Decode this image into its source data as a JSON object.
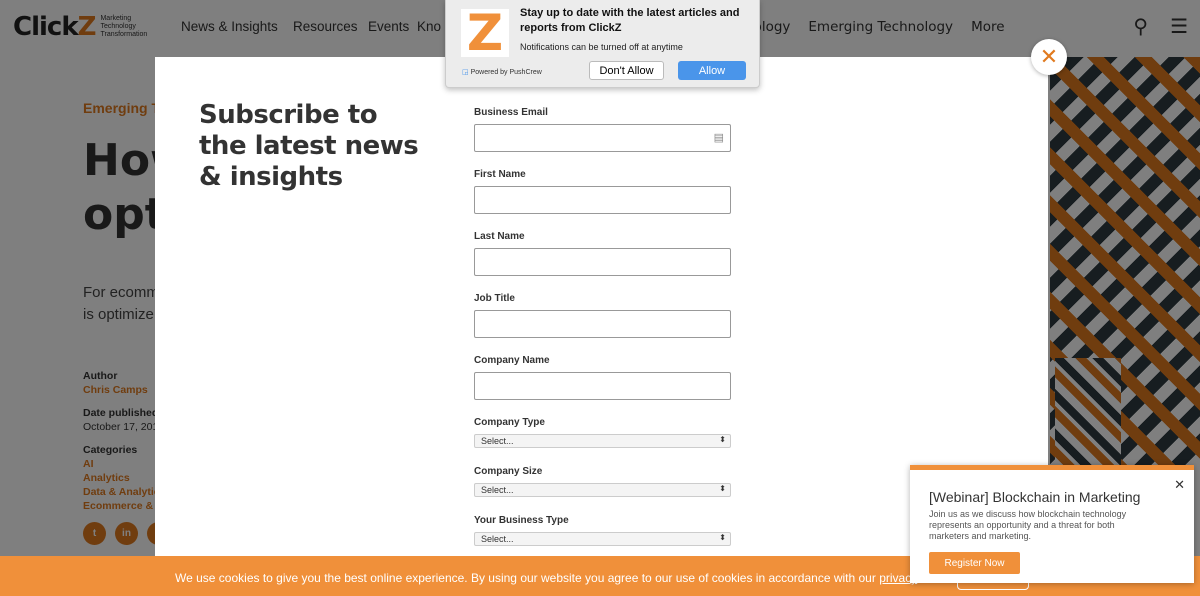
{
  "header": {
    "logo": "ClickZ",
    "logo_tagline": "Marketing Technology Transformation",
    "nav": [
      "News & Insights",
      "Resources",
      "Events",
      "Kno"
    ],
    "nav_right": [
      "nology",
      "Emerging Technology",
      "More"
    ]
  },
  "article": {
    "kicker": "Emerging Te",
    "title_lines": [
      "How",
      "opti"
    ],
    "lede_lines": [
      "For ecomm",
      "is optimize"
    ],
    "author_label": "Author",
    "author": "Chris Camps",
    "date_label": "Date published",
    "date": "October 17, 201",
    "categories_label": "Categories",
    "categories": [
      "AI",
      "Analytics",
      "Data & Analytic",
      "Ecommerce & S"
    ]
  },
  "modal": {
    "heading": "Subscribe to the latest news & insights",
    "fields": [
      "Business Email",
      "First Name",
      "Last Name",
      "Job Title",
      "Company Name"
    ],
    "selects": [
      {
        "label": "Company Type",
        "value": "Select..."
      },
      {
        "label": "Company Size",
        "value": "Select..."
      },
      {
        "label": "Your Business Type",
        "value": "Select..."
      }
    ]
  },
  "push": {
    "title": "Stay up to date with the latest articles and reports from ClickZ",
    "subtitle": "Notifications can be turned off at anytime",
    "powered": "Powered by PushCrew",
    "deny": "Don't Allow",
    "allow": "Allow",
    "logo": "Z"
  },
  "cookie": {
    "text": "We use cookies to give you the best online experience. By using our website you agree to our use of cookies in accordance with our ",
    "link": "privacy"
  },
  "webinar": {
    "title": "[Webinar] Blockchain in Marketing",
    "desc": "Join us as we discuss how blockchain technology represents an opportunity and a threat for both marketers and marketing.",
    "button": "Register Now"
  },
  "colors": {
    "accent": "#f0903a",
    "allow": "#4a95ea"
  }
}
